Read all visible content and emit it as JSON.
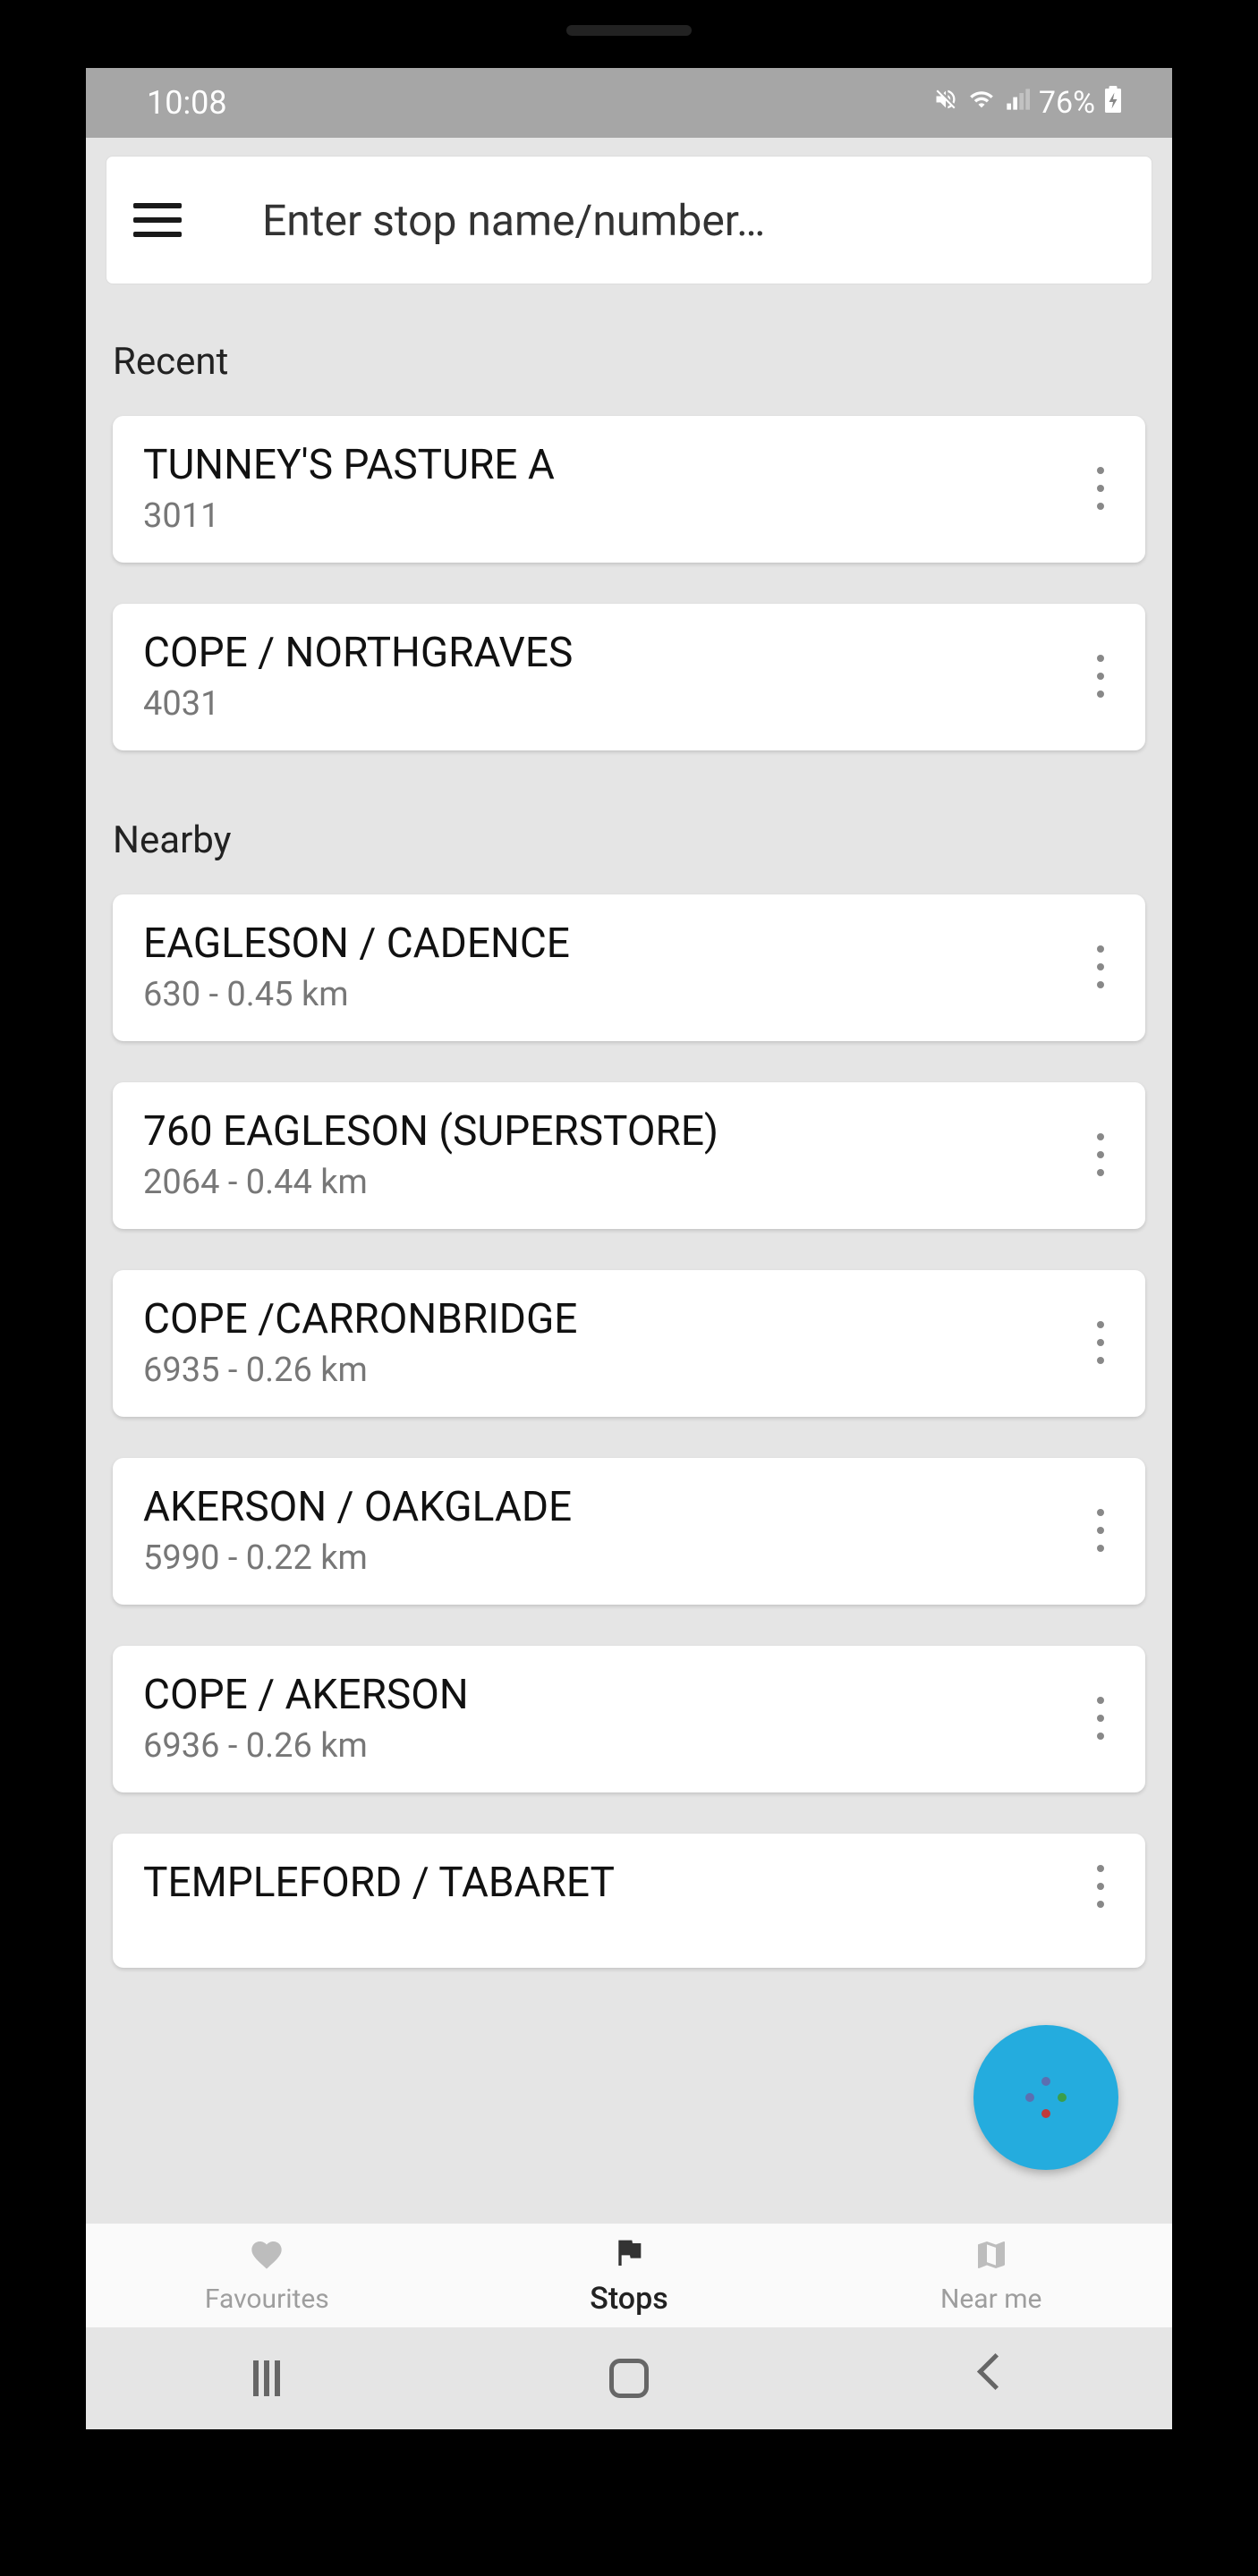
{
  "status": {
    "time": "10:08",
    "battery": "76%"
  },
  "search": {
    "placeholder": "Enter stop name/number…"
  },
  "sections": {
    "recent_label": "Recent",
    "nearby_label": "Nearby"
  },
  "recent": [
    {
      "title": "TUNNEY'S PASTURE A",
      "sub": "3011"
    },
    {
      "title": "COPE / NORTHGRAVES",
      "sub": "4031"
    }
  ],
  "nearby": [
    {
      "title": "EAGLESON / CADENCE",
      "sub": "630 - 0.45 km"
    },
    {
      "title": "760 EAGLESON (SUPERSTORE)",
      "sub": "2064 - 0.44 km"
    },
    {
      "title": "COPE /CARRONBRIDGE",
      "sub": "6935 - 0.26 km"
    },
    {
      "title": "AKERSON / OAKGLADE",
      "sub": "5990 - 0.22 km"
    },
    {
      "title": "COPE / AKERSON",
      "sub": "6936 - 0.26 km"
    },
    {
      "title": "TEMPLEFORD / TABARET",
      "sub": ""
    }
  ],
  "nav": {
    "favourites": "Favourites",
    "stops": "Stops",
    "nearme": "Near me"
  }
}
